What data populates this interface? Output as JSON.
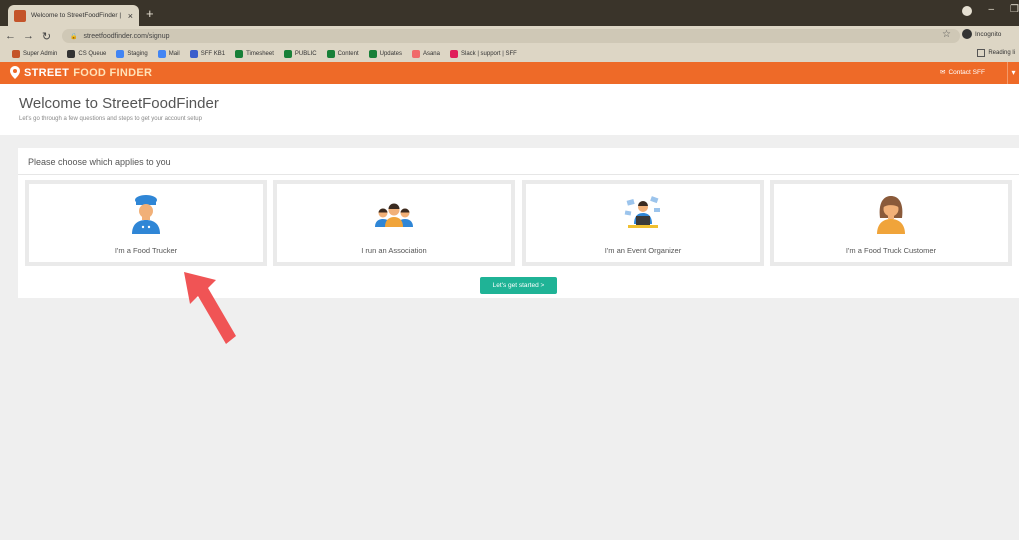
{
  "browser": {
    "tab_title": "Welcome to StreetFoodFinder | S",
    "tab_close": "×",
    "new_tab": "+",
    "url": "streetfoodfinder.com/signup",
    "profile": "Incognito",
    "reading_list": "Reading li",
    "bookmarks": [
      {
        "label": "Super Admin",
        "color": "#c4542a"
      },
      {
        "label": "CS Queue",
        "color": "#333333"
      },
      {
        "label": "Staging",
        "color": "#4285f4"
      },
      {
        "label": "Mail",
        "color": "#4285f4"
      },
      {
        "label": "SFF KB1",
        "color": "#3b5ecc"
      },
      {
        "label": "Timesheet",
        "color": "#188038"
      },
      {
        "label": "PUBLIC",
        "color": "#188038"
      },
      {
        "label": "Content",
        "color": "#188038"
      },
      {
        "label": "Updates",
        "color": "#188038"
      },
      {
        "label": "Asana",
        "color": "#f06a6a"
      },
      {
        "label": "Slack | support | SFF",
        "color": "#e01e5a"
      }
    ]
  },
  "header": {
    "logo_street": "STREET",
    "logo_food": "FOOD FINDER",
    "contact": "Contact SFF",
    "brand_color": "#ee6a28"
  },
  "page": {
    "title": "Welcome to StreetFoodFinder",
    "subtitle": "Let's go through a few questions and steps to get your account setup"
  },
  "chooser": {
    "title": "Please choose which applies to you",
    "options": [
      {
        "label": "I'm a Food Trucker",
        "icon": "chef-icon"
      },
      {
        "label": "I run an Association",
        "icon": "group-icon"
      },
      {
        "label": "I'm an Event Organizer",
        "icon": "organizer-icon"
      },
      {
        "label": "I'm a Food Truck Customer",
        "icon": "customer-icon"
      }
    ],
    "cta": "Let's get started >",
    "cta_color": "#1fb396"
  },
  "annotation": {
    "arrow_color": "#f05455"
  }
}
